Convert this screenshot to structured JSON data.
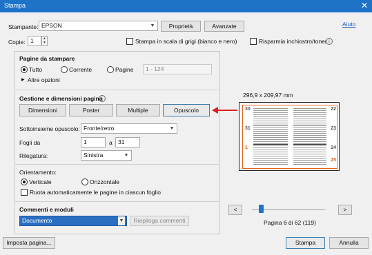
{
  "window": {
    "title": "Stampa",
    "close_glyph": "✕"
  },
  "top": {
    "printer_label": "Stampante:",
    "printer_value": "EPSON",
    "properties_button": "Proprietà",
    "advanced_button": "Avanzate",
    "help_link": "Aiuto",
    "copies_label": "Copie:",
    "copies_value": "1",
    "grayscale_label": "Stampa in scala di grigi (bianco e nero)",
    "grayscale_checked": false,
    "save_ink_label": "Risparmia inchiostro/toner",
    "save_ink_checked": false
  },
  "pages": {
    "title": "Pagine da stampare",
    "all_label": "Tutto",
    "current_label": "Corrente",
    "pages_label": "Pagine",
    "pages_value": "1 - 124",
    "more_options": "Altre opzioni"
  },
  "page_handling": {
    "title": "Gestione e dimensioni pagina",
    "tabs": [
      "Dimensioni",
      "Poster",
      "Multiple",
      "Opuscolo"
    ],
    "subset_label": "Sottoinsieme opuscolo:",
    "subset_value": "Fronte/retro",
    "sheets_label": "Fogli da",
    "sheets_from": "1",
    "sheets_to_label": "a",
    "sheets_to": "31",
    "binding_label": "Rilegatura:",
    "binding_value": "Sinistra"
  },
  "orientation": {
    "title": "Orientamento:",
    "portrait_label": "Verticale",
    "landscape_label": "Orizzontale",
    "auto_rotate_label": "Ruota automaticamente le pagine in ciascun foglio"
  },
  "comments": {
    "title": "Commenti e moduli",
    "value": "Documento",
    "summary_button": "Riepiloga commenti"
  },
  "preview": {
    "size_text": "296,9 x 209,97 mm",
    "page_numbers": [
      "30",
      "22",
      "31",
      "23",
      "1",
      "24",
      "25"
    ],
    "page_text": "Pagina 6 di 62 (119)",
    "prev_glyph": "<",
    "next_glyph": ">"
  },
  "bottom": {
    "page_setup_button": "Imposta pagina...",
    "print_button": "Stampa",
    "cancel_button": "Annulla"
  },
  "colors": {
    "titlebar": "#1e73c9",
    "arrow": "#d91f1f",
    "accent_orange": "#e0641c"
  }
}
